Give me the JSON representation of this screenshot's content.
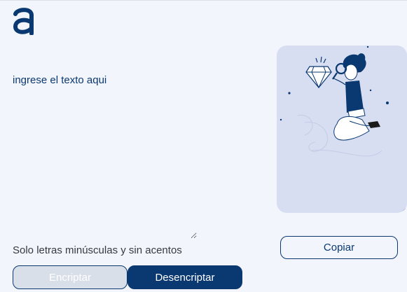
{
  "editor": {
    "placeholder": "ingrese el texto aqui",
    "hint": "Solo letras minúsculas y sin acentos"
  },
  "actions": {
    "encrypt_label": "Encriptar",
    "decrypt_label": "Desencriptar",
    "copy_label": "Copiar"
  },
  "colors": {
    "primary": "#0a3871",
    "background": "#f3f5fc",
    "panel": "#d8def2",
    "disabled_button": "#d8dfe8"
  },
  "icons": {
    "logo": "alura-a-logo",
    "illustration": "person-with-magnifier-and-diamond"
  }
}
